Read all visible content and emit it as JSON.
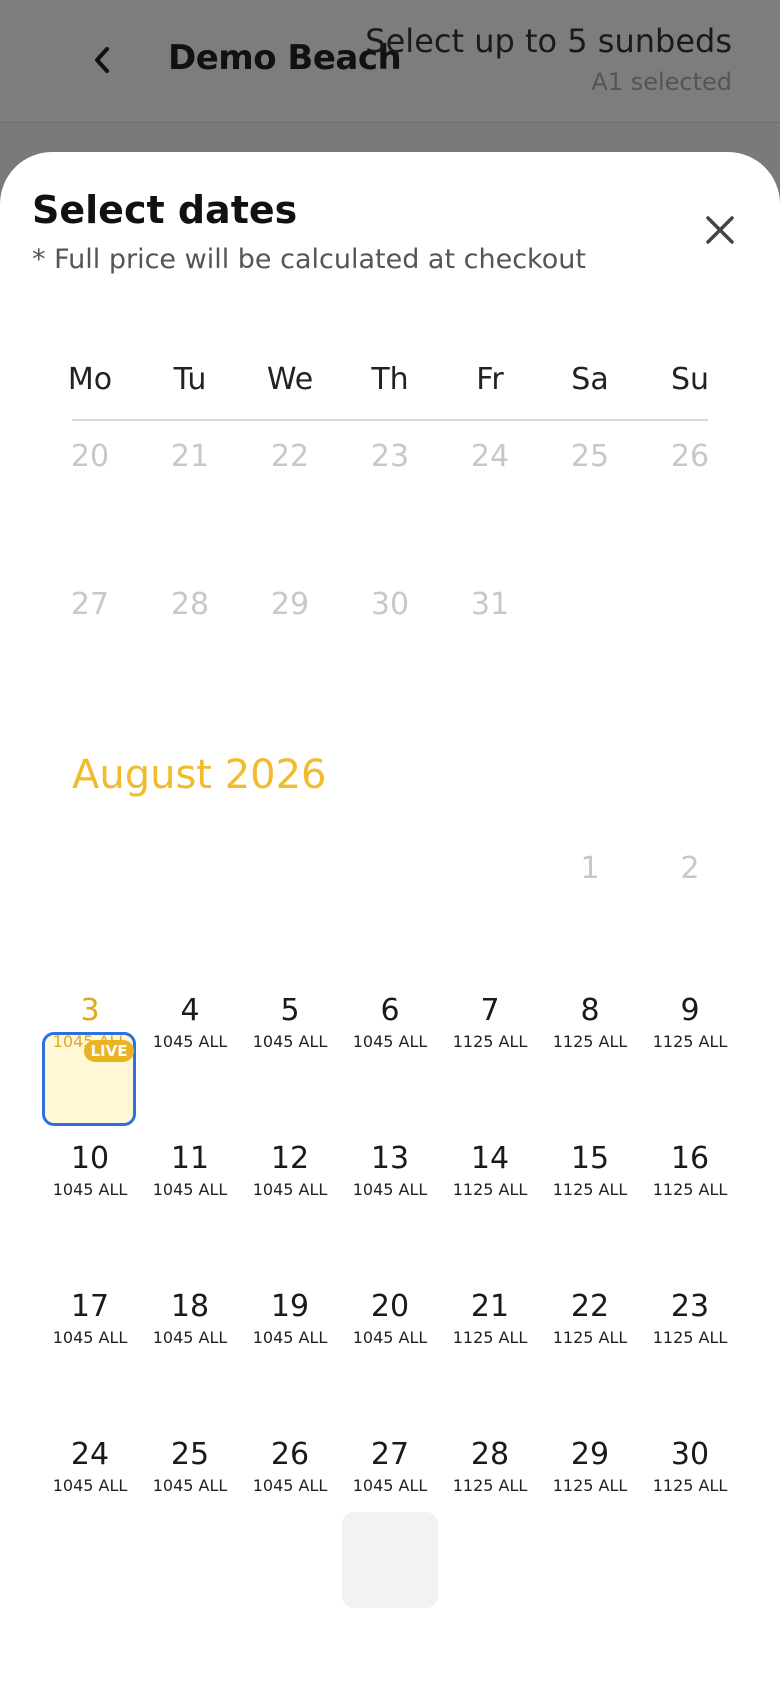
{
  "header": {
    "title": "Demo Beach",
    "sunbed_hint": "Select up to 5 sunbeds",
    "selected_hint": "A1 selected",
    "back_icon": "chevron-left-icon"
  },
  "sheet": {
    "title": "Select dates",
    "subtitle": "* Full price will be calculated at checkout",
    "close_icon": "close-icon"
  },
  "weekdays": [
    "Mo",
    "Tu",
    "We",
    "Th",
    "Fr",
    "Sa",
    "Su"
  ],
  "prev_month_days": {
    "week1": [
      "20",
      "21",
      "22",
      "23",
      "24",
      "25",
      "26"
    ],
    "week2": [
      "27",
      "28",
      "29",
      "30",
      "31"
    ]
  },
  "month": {
    "label": "August 2026",
    "leading_days": [
      "1",
      "2"
    ],
    "weeks": [
      [
        {
          "day": "3",
          "price": "1045 ALL",
          "live": "LIVE"
        },
        {
          "day": "4",
          "price": "1045 ALL"
        },
        {
          "day": "5",
          "price": "1045 ALL"
        },
        {
          "day": "6",
          "price": "1045 ALL"
        },
        {
          "day": "7",
          "price": "1125 ALL"
        },
        {
          "day": "8",
          "price": "1125 ALL"
        },
        {
          "day": "9",
          "price": "1125 ALL"
        }
      ],
      [
        {
          "day": "10",
          "price": "1045 ALL"
        },
        {
          "day": "11",
          "price": "1045 ALL"
        },
        {
          "day": "12",
          "price": "1045 ALL"
        },
        {
          "day": "13",
          "price": "1045 ALL"
        },
        {
          "day": "14",
          "price": "1125 ALL"
        },
        {
          "day": "15",
          "price": "1125 ALL"
        },
        {
          "day": "16",
          "price": "1125 ALL"
        }
      ],
      [
        {
          "day": "17",
          "price": "1045 ALL"
        },
        {
          "day": "18",
          "price": "1045 ALL"
        },
        {
          "day": "19",
          "price": "1045 ALL"
        },
        {
          "day": "20",
          "price": "1045 ALL"
        },
        {
          "day": "21",
          "price": "1125 ALL"
        },
        {
          "day": "22",
          "price": "1125 ALL"
        },
        {
          "day": "23",
          "price": "1125 ALL"
        }
      ],
      [
        {
          "day": "24",
          "price": "1045 ALL"
        },
        {
          "day": "25",
          "price": "1045 ALL"
        },
        {
          "day": "26",
          "price": "1045 ALL"
        },
        {
          "day": "27",
          "price": "1045 ALL"
        },
        {
          "day": "28",
          "price": "1125 ALL"
        },
        {
          "day": "29",
          "price": "1125 ALL"
        },
        {
          "day": "30",
          "price": "1125 ALL"
        }
      ]
    ]
  },
  "colors": {
    "accent": "#f0bc2c",
    "today_border": "#2f6fe0",
    "today_fill": "#fff7d6",
    "muted_day": "#c8c8c8",
    "overlay": "#7d7d7d"
  }
}
